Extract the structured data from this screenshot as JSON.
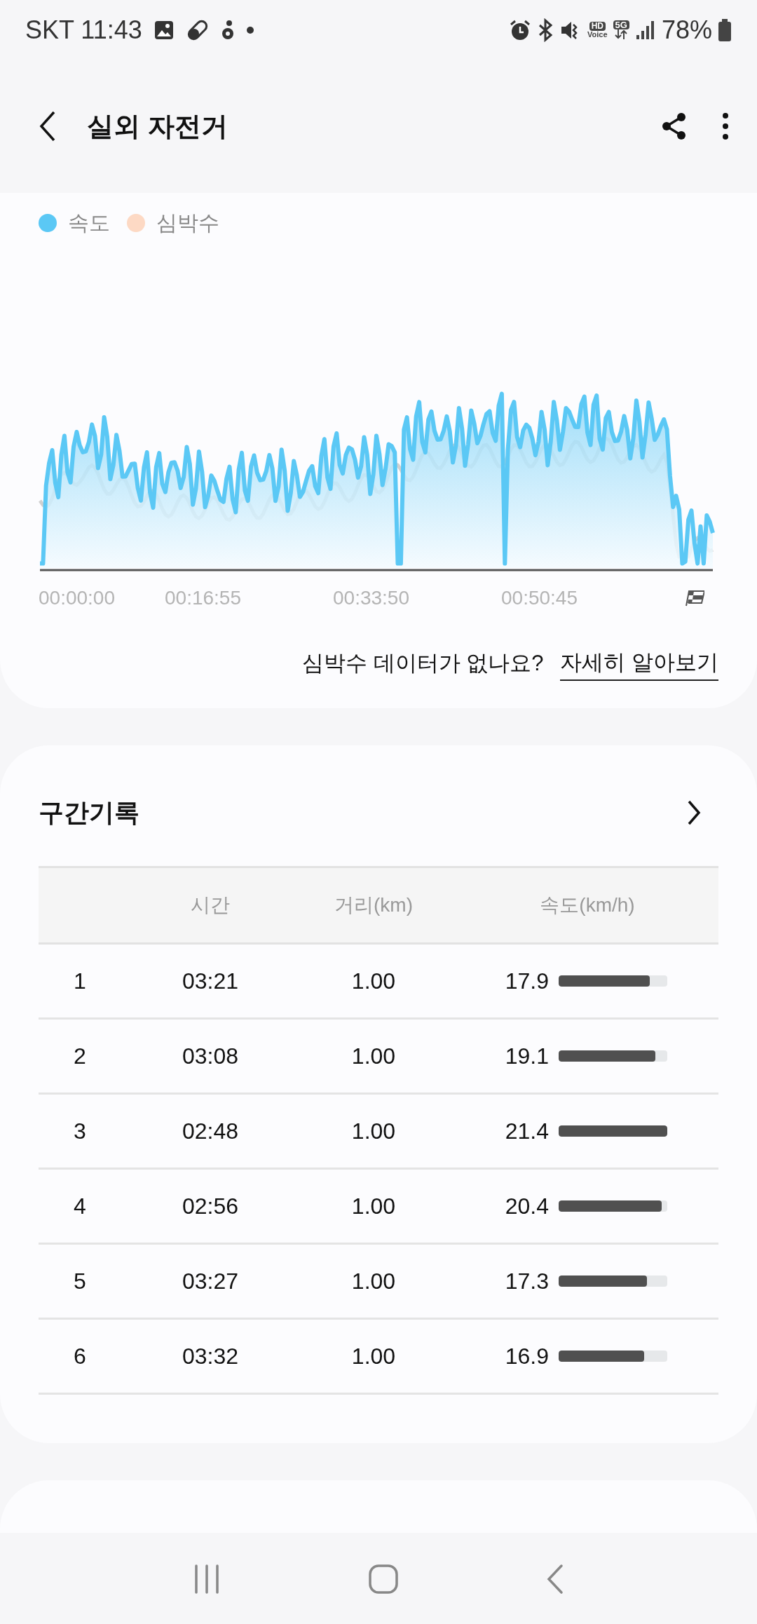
{
  "status_bar": {
    "carrier_time": "SKT 11:43",
    "hd_voice": {
      "top": "HD",
      "bottom": "Voice"
    },
    "network": "5G",
    "battery": "78%"
  },
  "header": {
    "title": "실외 자전거"
  },
  "chart_card": {
    "legend": [
      {
        "label": "속도",
        "color": "#5bc8f5"
      },
      {
        "label": "심박수",
        "color": "#fdd9c4"
      }
    ],
    "x_labels": [
      "00:00:00",
      "00:16:55",
      "00:33:50",
      "00:50:45"
    ],
    "note": "심박수 데이터가 없나요?",
    "link": "자세히 알아보기"
  },
  "laps": {
    "title": "구간기록",
    "columns": [
      "",
      "시간",
      "거리(km)",
      "속도(km/h)"
    ],
    "rows": [
      {
        "index": "1",
        "time": "03:21",
        "distance": "1.00",
        "speed": "17.9",
        "level": 0.84
      },
      {
        "index": "2",
        "time": "03:08",
        "distance": "1.00",
        "speed": "19.1",
        "level": 0.89
      },
      {
        "index": "3",
        "time": "02:48",
        "distance": "1.00",
        "speed": "21.4",
        "level": 1.0
      },
      {
        "index": "4",
        "time": "02:56",
        "distance": "1.00",
        "speed": "20.4",
        "level": 0.95
      },
      {
        "index": "5",
        "time": "03:27",
        "distance": "1.00",
        "speed": "17.3",
        "level": 0.81
      },
      {
        "index": "6",
        "time": "03:32",
        "distance": "1.00",
        "speed": "16.9",
        "level": 0.79
      }
    ]
  }
}
